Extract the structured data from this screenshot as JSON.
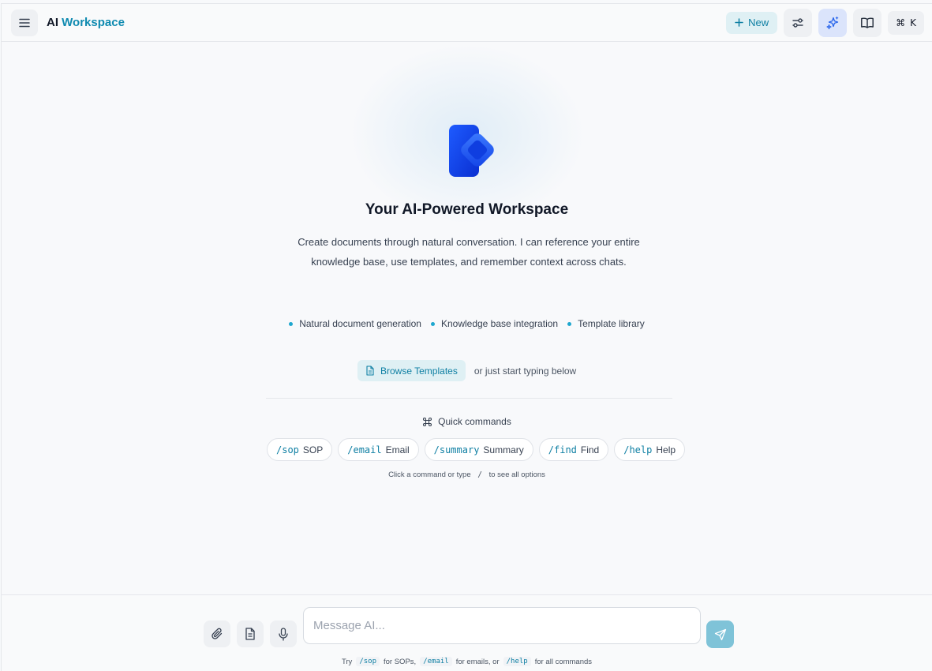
{
  "header": {
    "title_plain": "AI ",
    "title_accent": "Workspace",
    "new_label": "New",
    "new_icon": "plus-icon",
    "kbd_symbol": "⌘",
    "kbd_key": "K",
    "icons": [
      "menu-icon",
      "sliders-icon",
      "sparkles-icon",
      "book-icon"
    ]
  },
  "hero": {
    "title": "Your AI-Powered Workspace",
    "description": "Create documents through natural conversation. I can reference your entire knowledge base, use templates, and remember context across chats.",
    "features": [
      "Natural document generation",
      "Knowledge base integration",
      "Template library"
    ],
    "browse_label": "Browse Templates",
    "browse_hint": "or just start typing below"
  },
  "quick_commands": {
    "title": "Quick commands",
    "items": [
      {
        "cmd": "/sop",
        "label": "SOP"
      },
      {
        "cmd": "/email",
        "label": "Email"
      },
      {
        "cmd": "/summary",
        "label": "Summary"
      },
      {
        "cmd": "/find",
        "label": "Find"
      },
      {
        "cmd": "/help",
        "label": "Help"
      }
    ],
    "hint_before": "Click a command or type",
    "hint_slash": "/",
    "hint_after": "to see all options"
  },
  "composer": {
    "placeholder": "Message AI...",
    "tools": [
      "paperclip-icon",
      "document-icon",
      "microphone-icon"
    ],
    "send_icon": "send-icon",
    "hint": {
      "t1": "Try",
      "c1": "/sop",
      "t2": "for SOPs,",
      "c2": "/email",
      "t3": "for emails, or",
      "c3": "/help",
      "t4": "for all commands"
    }
  },
  "colors": {
    "accent": "#0e8ab0",
    "accent_bg": "#dff0f4",
    "logo_blue": "#1d4ed8",
    "send_bg": "#7fc3d8"
  }
}
